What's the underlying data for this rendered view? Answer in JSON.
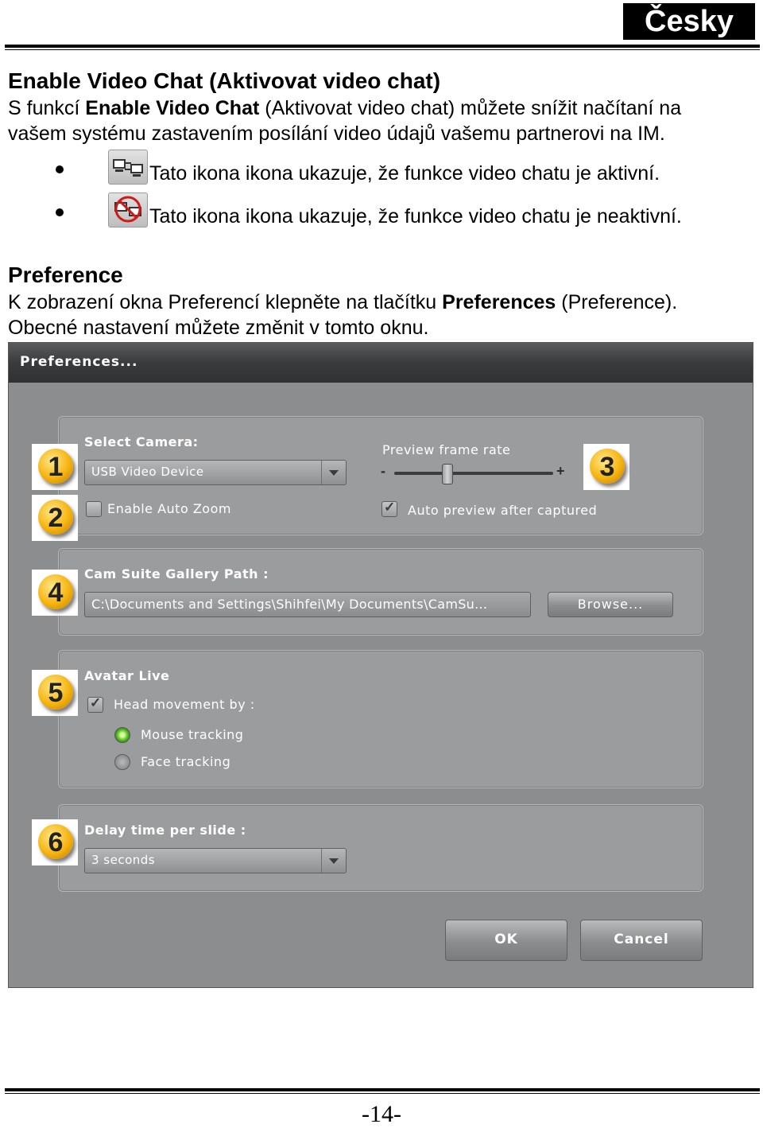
{
  "header": {
    "language": "Česky"
  },
  "section1": {
    "title": "Enable Video Chat (Aktivovat video chat)",
    "para_prefix": "S funkcí ",
    "para_bold": "Enable Video Chat",
    "para_suffix": " (Aktivovat video chat) můžete snížit načítaní na",
    "para_line2": "vašem systému zastavením posílání video údajů vašemu partnerovi na IM.",
    "bullets": [
      {
        "icon": "video-chat-active-icon",
        "text": "Tato ikona ikona ukazuje, že funkce video chatu je aktivní."
      },
      {
        "icon": "video-chat-inactive-icon",
        "text": "Tato ikona ikona ukazuje, že funkce video chatu je neaktivní."
      }
    ]
  },
  "section2": {
    "title": "Preference",
    "para_prefix": "K zobrazení okna Preferencí klepněte na tlačítku ",
    "para_bold": "Preferences",
    "para_suffix": " (Preference).",
    "para_line2": "Obecné nastavení můžete změnit v tomto oknu."
  },
  "prefs_window": {
    "title": "Preferences...",
    "select_camera_label": "Select Camera:",
    "camera_value": "USB Video Device",
    "preview_frame_rate_label": "Preview frame rate",
    "preview_frame_rate_level": 0.33,
    "slider_minus": "-",
    "slider_plus": "+",
    "enable_auto_zoom_label": "Enable Auto Zoom",
    "enable_auto_zoom_checked": false,
    "auto_preview_label": "Auto preview after captured",
    "auto_preview_checked": true,
    "gallery_path_label": "Cam Suite Gallery Path :",
    "gallery_path_value": "C:\\Documents and Settings\\Shihfei\\My Documents\\CamSu...",
    "browse_label": "Browse...",
    "avatar_live_label": "Avatar Live",
    "head_movement_label": "Head movement by :",
    "head_movement_checked": true,
    "mouse_tracking_label": "Mouse tracking",
    "face_tracking_label": "Face tracking",
    "selected_tracking": "Mouse tracking",
    "delay_label": "Delay time per slide :",
    "delay_value": "3 seconds",
    "ok_label": "OK",
    "cancel_label": "Cancel"
  },
  "callouts": [
    "1",
    "2",
    "3",
    "4",
    "5",
    "6"
  ],
  "colors": {
    "callout": "#f6b410",
    "window_bg": "#8b8d8f",
    "radio_on": "#6ad02a"
  },
  "footer": {
    "page_number": "-14-"
  }
}
